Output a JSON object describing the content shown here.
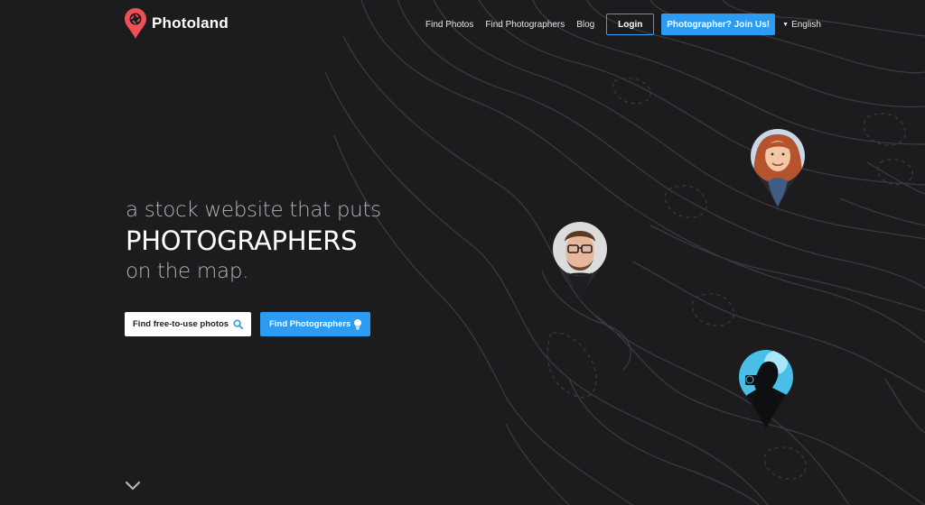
{
  "brand": {
    "name": "Photoland",
    "accent": "#ef4f55"
  },
  "nav": {
    "links": [
      "Find Photos",
      "Find Photographers",
      "Blog"
    ],
    "login": "Login",
    "join": "Photographer? Join Us!",
    "language": "English"
  },
  "hero": {
    "line1": "a stock website that puts",
    "line2": "PHOTOGRAPHERS",
    "line3": "on the map."
  },
  "cta": {
    "photos": "Find free-to-use photos",
    "photographers": "Find Photographers"
  },
  "colors": {
    "background": "#1c1c1f",
    "primary": "#2b9cf2",
    "topo_lines": "#3a3a3f"
  },
  "icons": [
    "logo-pin-icon",
    "search-icon",
    "lightbulb-icon",
    "chevron-down-icon",
    "caret-down-icon"
  ]
}
